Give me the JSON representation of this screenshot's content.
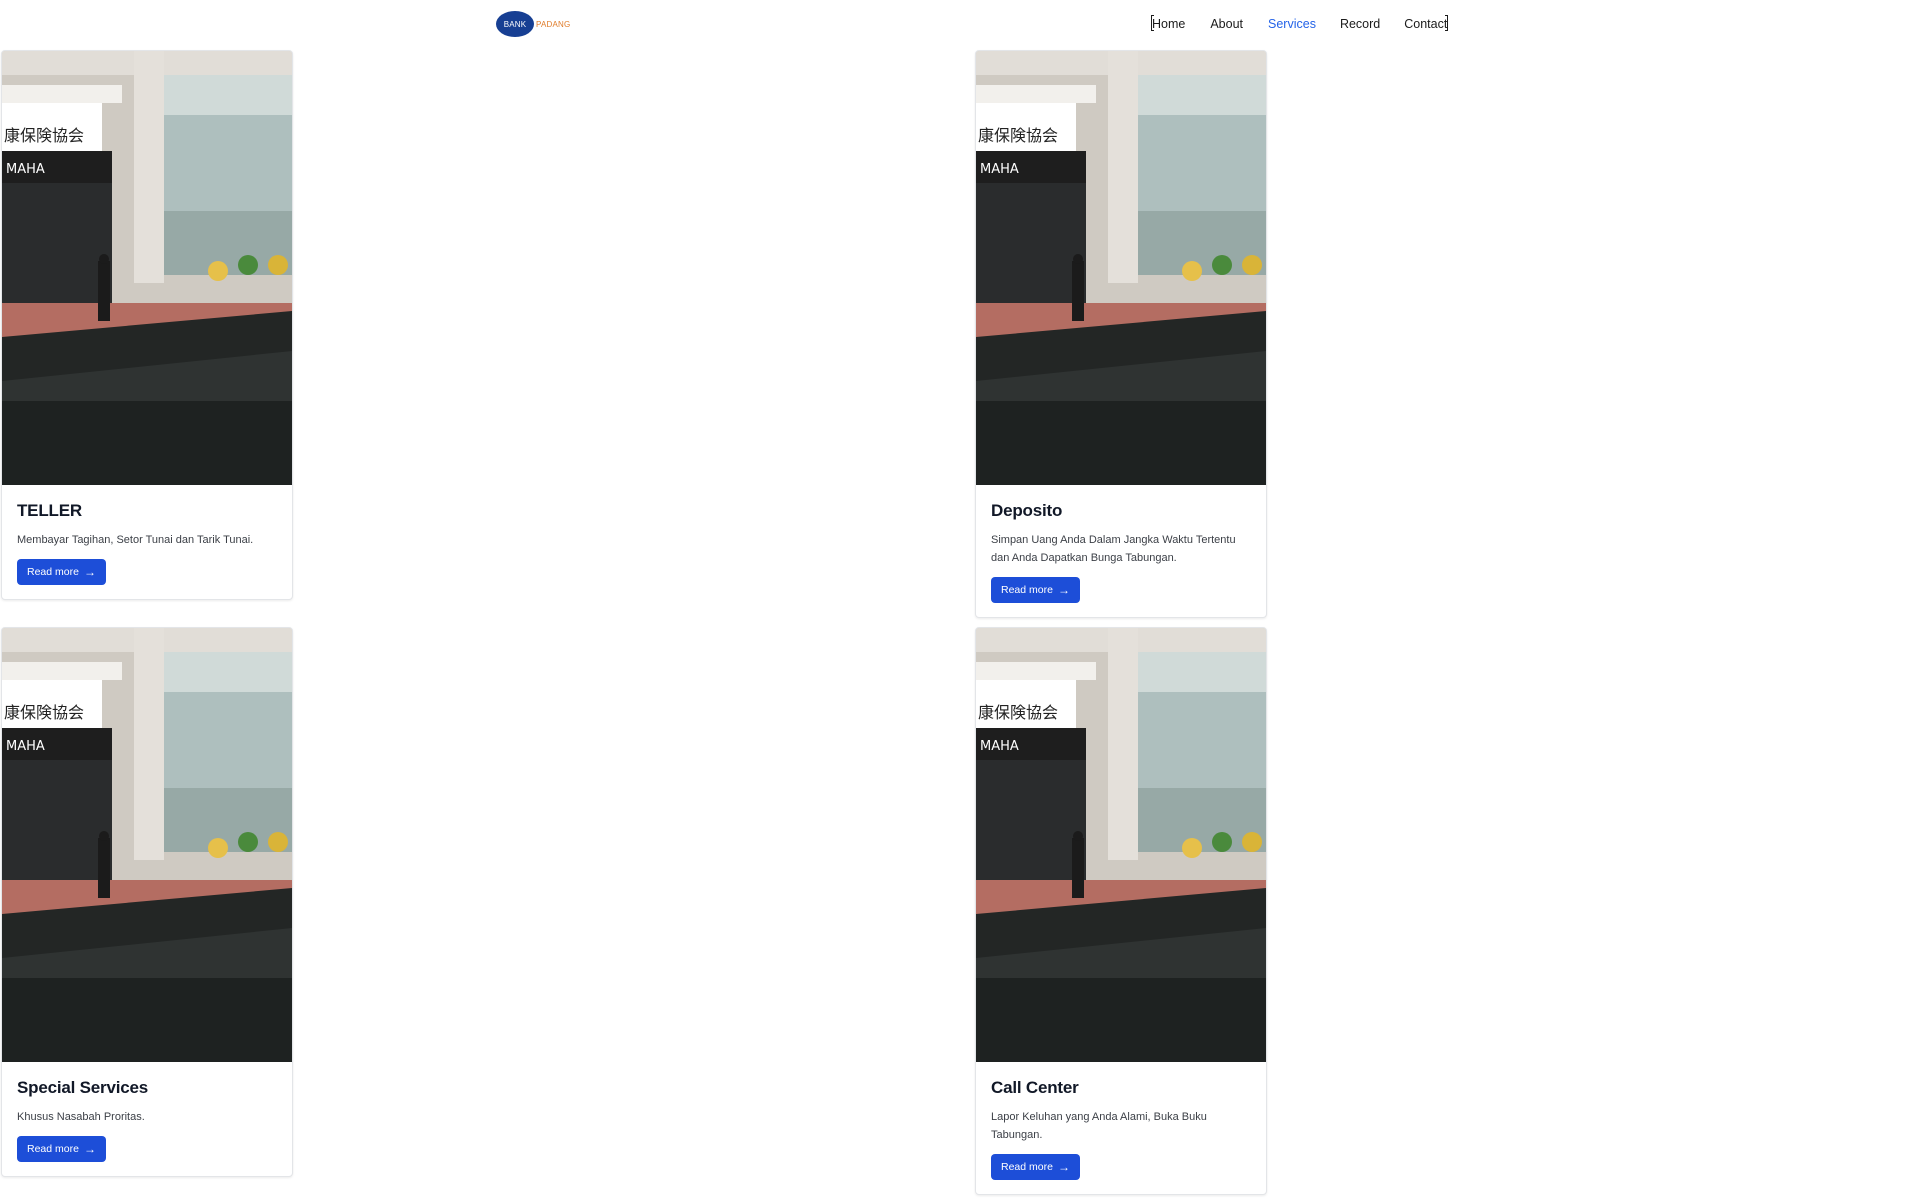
{
  "header": {
    "logo": {
      "bank_text": "BANK",
      "padang_text": "PADANG"
    },
    "nav": [
      {
        "label": "Home"
      },
      {
        "label": "About"
      },
      {
        "label": "Services",
        "active": true
      },
      {
        "label": "Record"
      },
      {
        "label": "Contact"
      }
    ]
  },
  "cards": [
    {
      "title": "TELLER",
      "description": "Membayar Tagihan, Setor Tunai dan Tarik Tunai.",
      "button": "Read more"
    },
    {
      "title": "Deposito",
      "description": "Simpan Uang Anda Dalam Jangka Waktu Tertentu dan Anda Dapatkan Bunga Tabungan.",
      "button": "Read more"
    },
    {
      "title": "Special Services",
      "description": "Khusus Nasabah Proritas.",
      "button": "Read more"
    },
    {
      "title": "Call Center",
      "description": "Lapor Keluhan yang Anda Alami, Buka Buku Tabungan.",
      "button": "Read more"
    }
  ],
  "colors": {
    "brand_blue": "#173f93",
    "brand_orange": "#e07c2a",
    "nav_active": "#2463e8",
    "button": "#1d4ed8"
  }
}
